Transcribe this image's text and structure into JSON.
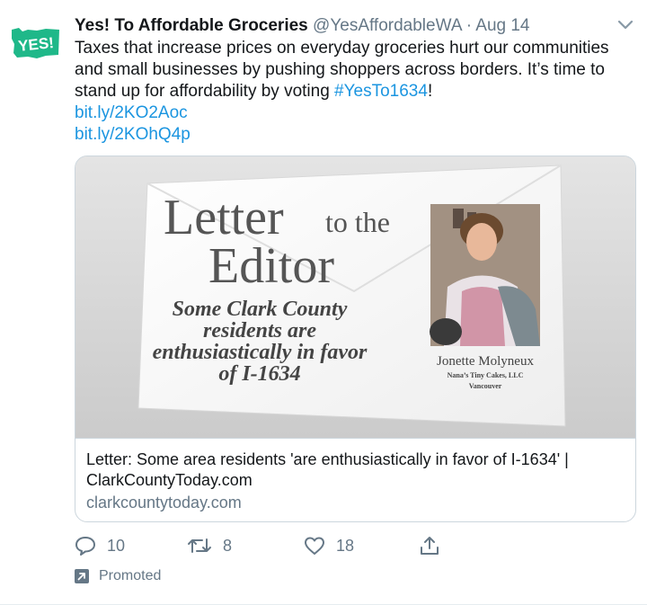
{
  "tweet": {
    "author_name": "Yes! To Affordable Groceries",
    "handle": "@YesAffordableWA",
    "separator": "·",
    "date": "Aug 14",
    "avatar_text": "YES!",
    "text_before": "Taxes that increase prices on everyday groceries hurt our communities and small businesses by pushing shoppers across borders. It’s time to stand up for affordability by voting ",
    "hashtag": "#YesTo1634",
    "text_after": "!",
    "links": [
      "bit.ly/2KO2Aoc",
      "bit.ly/2KOhQ4p"
    ]
  },
  "card": {
    "image": {
      "headline_1": "Letter",
      "headline_2": "to the",
      "headline_3": "Editor",
      "subhead": [
        "Some Clark County",
        "residents are",
        "enthusiastically in favor",
        "of I-1634"
      ],
      "person_name": "Jonette Molyneux",
      "business": "Nana’s Tiny Cakes, LLC",
      "city": "Vancouver"
    },
    "title": "Letter: Some area residents 'are enthusiastically in favor of I-1634' | ClarkCountyToday.com",
    "domain": "clarkcountytoday.com"
  },
  "actions": {
    "replies": "10",
    "retweets": "8",
    "likes": "18"
  },
  "promoted_label": "Promoted",
  "colors": {
    "link": "#1b95e0",
    "muted": "#657786",
    "avatar_green": "#1fb889",
    "border": "#ccd6dd"
  },
  "icons": [
    "reply-icon",
    "retweet-icon",
    "like-icon",
    "share-icon",
    "promoted-icon",
    "chevron-down-icon"
  ]
}
